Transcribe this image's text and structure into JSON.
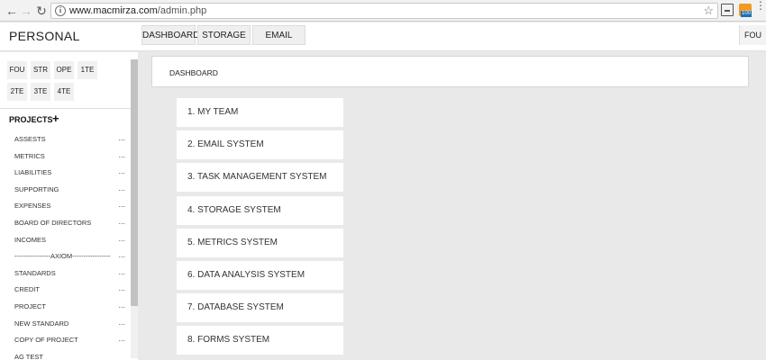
{
  "browser": {
    "url_host": "www.macmirza.com",
    "url_path": "/admin.php",
    "back_icon": "arrow-left-icon",
    "forward_icon": "arrow-right-icon",
    "reload_icon": "reload-icon",
    "rss_badge": "100"
  },
  "header": {
    "brand": "PERSONAL",
    "tabs": [
      {
        "label": "DASHBOARD"
      },
      {
        "label": "STORAGE"
      },
      {
        "label": "EMAIL"
      }
    ],
    "user": "FOU"
  },
  "sidebar": {
    "quick_tags": [
      "FOU",
      "STR",
      "OPE",
      "1TE",
      "2TE",
      "3TE",
      "4TE"
    ],
    "projects_title": "PROJECTS",
    "projects": [
      {
        "label": "ASSESTS",
        "more": "..."
      },
      {
        "label": "METRICS",
        "more": "..."
      },
      {
        "label": "LIABILITIES",
        "more": "..."
      },
      {
        "label": "SUPPORTING",
        "more": "..."
      },
      {
        "label": "EXPENSES",
        "more": "..."
      },
      {
        "label": "BOARD OF DIRECTORS",
        "more": "..."
      },
      {
        "label": "INCOMES",
        "more": "..."
      },
      {
        "label": "----------------AXIOM-----------------",
        "more": "..."
      },
      {
        "label": "STANDARDS",
        "more": "..."
      },
      {
        "label": "CREDIT",
        "more": "..."
      },
      {
        "label": "PROJECT",
        "more": "..."
      },
      {
        "label": "NEW STANDARD",
        "more": "..."
      },
      {
        "label": "COPY OF PROJECT",
        "more": "..."
      },
      {
        "label": "AG TEST",
        "more": ""
      }
    ]
  },
  "main": {
    "panel_title": "DASHBOARD",
    "systems": [
      "1. MY TEAM",
      "2. EMAIL SYSTEM",
      "3. TASK MANAGEMENT SYSTEM",
      "4. STORAGE SYSTEM",
      "5. METRICS SYSTEM",
      "6. DATA ANALYSIS SYSTEM",
      "7. DATABASE SYSTEM",
      "8. FORMS SYSTEM"
    ]
  },
  "colors": {
    "page_bg": "#e9e9e9",
    "card_bg": "#ffffff",
    "tab_bg": "#efefef",
    "rss": "#f29a1f"
  }
}
